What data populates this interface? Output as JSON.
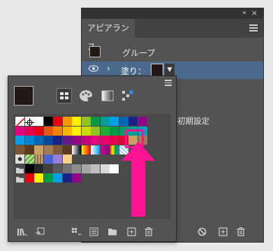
{
  "appearance": {
    "tab_title": "アピアランス",
    "group_label": "グループ",
    "fill_label": "塗り：",
    "default_label": "初期設定",
    "fill_color": "#231816"
  },
  "swatches": {
    "current_fill": "#231816",
    "rows": [
      [
        "none",
        "registration",
        "#ffffff",
        "#000000",
        "#e60012",
        "#f39800",
        "#fff100",
        "#8fc31f",
        "#009944",
        "#009e96",
        "#00a0e9",
        "#0068b7",
        "#1d2088",
        "#920783"
      ],
      [
        "#e4007f",
        "#e5004f",
        "#e60012",
        "#e95513",
        "#f08300",
        "#f8b500",
        "#fff100",
        "#cfdb00",
        "#8fc31f",
        "#22ac38",
        "#009944",
        "#009b6b",
        "#009e96",
        "#00a0c1"
      ],
      [
        "#00a0e9",
        "#0086d1",
        "#0068b7",
        "#00479d",
        "#1d2088",
        "#601986",
        "#920783",
        "#be0081",
        "#e4007f",
        "#e5006a",
        "#e5004f",
        "#e60033",
        "#c8a063",
        "#a47b51"
      ],
      [
        "#7c5433",
        "#5b3b1e",
        "#c8a063",
        "#a47b51",
        "#7d5b3b",
        "#5a3a22",
        "gradient-bw",
        "gradient-orange",
        "gradient-blue",
        "gradient-purple",
        "gradient-rainbow",
        "pattern-check",
        "",
        ""
      ],
      [
        "pattern-dots",
        "pattern-leaf",
        "pattern-wood",
        "#4a63d6",
        "#9a7dd9",
        "#f7d089",
        "",
        "",
        "",
        "",
        "",
        "",
        "",
        ""
      ],
      [
        "folder",
        "#000000",
        "#262626",
        "#404040",
        "#595959",
        "#737373",
        "#8c8c8c",
        "#a6a6a6",
        "#bfbfbf",
        "#d9d9d9",
        "#ffffff",
        "",
        "",
        ""
      ],
      [
        "folder",
        "#e60012",
        "#fff100",
        "#009944",
        "#00a0e9",
        "#1d2088",
        "#920783",
        "",
        "",
        "",
        "",
        "",
        "",
        ""
      ]
    ],
    "highlight_color": "#ff1493"
  },
  "icons": {
    "appearance_bottom": [
      "no-sign-icon",
      "new-item-icon",
      "trash-icon"
    ],
    "swatches_bottom": [
      "library-icon",
      "place-icon",
      "show-kinds-icon",
      "swatch-options-icon",
      "new-group-icon",
      "new-swatch-icon",
      "trash-icon"
    ]
  }
}
